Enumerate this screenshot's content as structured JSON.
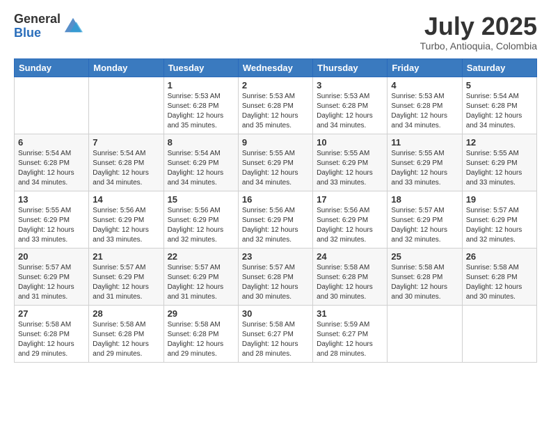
{
  "logo": {
    "general": "General",
    "blue": "Blue"
  },
  "header": {
    "month": "July 2025",
    "location": "Turbo, Antioquia, Colombia"
  },
  "days_of_week": [
    "Sunday",
    "Monday",
    "Tuesday",
    "Wednesday",
    "Thursday",
    "Friday",
    "Saturday"
  ],
  "weeks": [
    [
      {
        "day": null
      },
      {
        "day": null
      },
      {
        "day": "1",
        "sunrise": "Sunrise: 5:53 AM",
        "sunset": "Sunset: 6:28 PM",
        "daylight": "Daylight: 12 hours and 35 minutes."
      },
      {
        "day": "2",
        "sunrise": "Sunrise: 5:53 AM",
        "sunset": "Sunset: 6:28 PM",
        "daylight": "Daylight: 12 hours and 35 minutes."
      },
      {
        "day": "3",
        "sunrise": "Sunrise: 5:53 AM",
        "sunset": "Sunset: 6:28 PM",
        "daylight": "Daylight: 12 hours and 34 minutes."
      },
      {
        "day": "4",
        "sunrise": "Sunrise: 5:53 AM",
        "sunset": "Sunset: 6:28 PM",
        "daylight": "Daylight: 12 hours and 34 minutes."
      },
      {
        "day": "5",
        "sunrise": "Sunrise: 5:54 AM",
        "sunset": "Sunset: 6:28 PM",
        "daylight": "Daylight: 12 hours and 34 minutes."
      }
    ],
    [
      {
        "day": "6",
        "sunrise": "Sunrise: 5:54 AM",
        "sunset": "Sunset: 6:28 PM",
        "daylight": "Daylight: 12 hours and 34 minutes."
      },
      {
        "day": "7",
        "sunrise": "Sunrise: 5:54 AM",
        "sunset": "Sunset: 6:28 PM",
        "daylight": "Daylight: 12 hours and 34 minutes."
      },
      {
        "day": "8",
        "sunrise": "Sunrise: 5:54 AM",
        "sunset": "Sunset: 6:29 PM",
        "daylight": "Daylight: 12 hours and 34 minutes."
      },
      {
        "day": "9",
        "sunrise": "Sunrise: 5:55 AM",
        "sunset": "Sunset: 6:29 PM",
        "daylight": "Daylight: 12 hours and 34 minutes."
      },
      {
        "day": "10",
        "sunrise": "Sunrise: 5:55 AM",
        "sunset": "Sunset: 6:29 PM",
        "daylight": "Daylight: 12 hours and 33 minutes."
      },
      {
        "day": "11",
        "sunrise": "Sunrise: 5:55 AM",
        "sunset": "Sunset: 6:29 PM",
        "daylight": "Daylight: 12 hours and 33 minutes."
      },
      {
        "day": "12",
        "sunrise": "Sunrise: 5:55 AM",
        "sunset": "Sunset: 6:29 PM",
        "daylight": "Daylight: 12 hours and 33 minutes."
      }
    ],
    [
      {
        "day": "13",
        "sunrise": "Sunrise: 5:55 AM",
        "sunset": "Sunset: 6:29 PM",
        "daylight": "Daylight: 12 hours and 33 minutes."
      },
      {
        "day": "14",
        "sunrise": "Sunrise: 5:56 AM",
        "sunset": "Sunset: 6:29 PM",
        "daylight": "Daylight: 12 hours and 33 minutes."
      },
      {
        "day": "15",
        "sunrise": "Sunrise: 5:56 AM",
        "sunset": "Sunset: 6:29 PM",
        "daylight": "Daylight: 12 hours and 32 minutes."
      },
      {
        "day": "16",
        "sunrise": "Sunrise: 5:56 AM",
        "sunset": "Sunset: 6:29 PM",
        "daylight": "Daylight: 12 hours and 32 minutes."
      },
      {
        "day": "17",
        "sunrise": "Sunrise: 5:56 AM",
        "sunset": "Sunset: 6:29 PM",
        "daylight": "Daylight: 12 hours and 32 minutes."
      },
      {
        "day": "18",
        "sunrise": "Sunrise: 5:57 AM",
        "sunset": "Sunset: 6:29 PM",
        "daylight": "Daylight: 12 hours and 32 minutes."
      },
      {
        "day": "19",
        "sunrise": "Sunrise: 5:57 AM",
        "sunset": "Sunset: 6:29 PM",
        "daylight": "Daylight: 12 hours and 32 minutes."
      }
    ],
    [
      {
        "day": "20",
        "sunrise": "Sunrise: 5:57 AM",
        "sunset": "Sunset: 6:29 PM",
        "daylight": "Daylight: 12 hours and 31 minutes."
      },
      {
        "day": "21",
        "sunrise": "Sunrise: 5:57 AM",
        "sunset": "Sunset: 6:29 PM",
        "daylight": "Daylight: 12 hours and 31 minutes."
      },
      {
        "day": "22",
        "sunrise": "Sunrise: 5:57 AM",
        "sunset": "Sunset: 6:29 PM",
        "daylight": "Daylight: 12 hours and 31 minutes."
      },
      {
        "day": "23",
        "sunrise": "Sunrise: 5:57 AM",
        "sunset": "Sunset: 6:28 PM",
        "daylight": "Daylight: 12 hours and 30 minutes."
      },
      {
        "day": "24",
        "sunrise": "Sunrise: 5:58 AM",
        "sunset": "Sunset: 6:28 PM",
        "daylight": "Daylight: 12 hours and 30 minutes."
      },
      {
        "day": "25",
        "sunrise": "Sunrise: 5:58 AM",
        "sunset": "Sunset: 6:28 PM",
        "daylight": "Daylight: 12 hours and 30 minutes."
      },
      {
        "day": "26",
        "sunrise": "Sunrise: 5:58 AM",
        "sunset": "Sunset: 6:28 PM",
        "daylight": "Daylight: 12 hours and 30 minutes."
      }
    ],
    [
      {
        "day": "27",
        "sunrise": "Sunrise: 5:58 AM",
        "sunset": "Sunset: 6:28 PM",
        "daylight": "Daylight: 12 hours and 29 minutes."
      },
      {
        "day": "28",
        "sunrise": "Sunrise: 5:58 AM",
        "sunset": "Sunset: 6:28 PM",
        "daylight": "Daylight: 12 hours and 29 minutes."
      },
      {
        "day": "29",
        "sunrise": "Sunrise: 5:58 AM",
        "sunset": "Sunset: 6:28 PM",
        "daylight": "Daylight: 12 hours and 29 minutes."
      },
      {
        "day": "30",
        "sunrise": "Sunrise: 5:58 AM",
        "sunset": "Sunset: 6:27 PM",
        "daylight": "Daylight: 12 hours and 28 minutes."
      },
      {
        "day": "31",
        "sunrise": "Sunrise: 5:59 AM",
        "sunset": "Sunset: 6:27 PM",
        "daylight": "Daylight: 12 hours and 28 minutes."
      },
      {
        "day": null
      },
      {
        "day": null
      }
    ]
  ]
}
